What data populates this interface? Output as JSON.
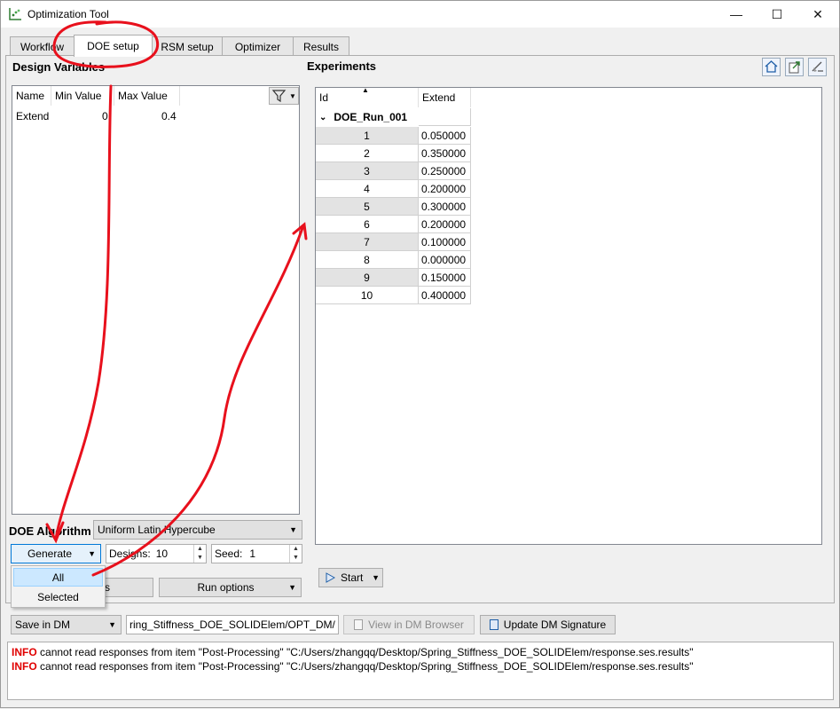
{
  "window": {
    "title": "Optimization Tool",
    "min_glyph": "—",
    "max_glyph": "☐",
    "close_glyph": "✕"
  },
  "tabs": [
    {
      "label": "Workflow"
    },
    {
      "label": "DOE setup"
    },
    {
      "label": "RSM setup"
    },
    {
      "label": "Optimizer"
    },
    {
      "label": "Results"
    }
  ],
  "design_variables": {
    "title": "Design Variables",
    "columns": [
      "Name",
      "Min Value",
      "Max Value"
    ],
    "rows": [
      {
        "name": "Extend",
        "min": "0.",
        "max": "0.4"
      }
    ]
  },
  "doe": {
    "algorithm_label": "DOE Algorithm",
    "algorithm_value": "Uniform Latin Hypercube",
    "generate_label": "Generate",
    "designs_label": "Designs:",
    "designs_value": "10",
    "seed_label": "Seed:",
    "seed_value": "1",
    "hidden_button_text": "s",
    "run_options_label": "Run options",
    "menu": [
      {
        "label": "All"
      },
      {
        "label": "Selected"
      }
    ]
  },
  "experiments": {
    "title": "Experiments",
    "columns": [
      "Id",
      "Extend"
    ],
    "group": "DOE_Run_001",
    "rows": [
      {
        "id": "1",
        "extend": "0.050000"
      },
      {
        "id": "2",
        "extend": "0.350000"
      },
      {
        "id": "3",
        "extend": "0.250000"
      },
      {
        "id": "4",
        "extend": "0.200000"
      },
      {
        "id": "5",
        "extend": "0.300000"
      },
      {
        "id": "6",
        "extend": "0.200000"
      },
      {
        "id": "7",
        "extend": "0.100000"
      },
      {
        "id": "8",
        "extend": "0.000000"
      },
      {
        "id": "9",
        "extend": "0.150000"
      },
      {
        "id": "10",
        "extend": "0.400000"
      }
    ],
    "start_label": "Start"
  },
  "bottom": {
    "save_select": "Save in DM",
    "path_value": "ring_Stiffness_DOE_SOLIDElem/OPT_DM/",
    "view_dm_label": "View in DM Browser",
    "update_dm_label": "Update DM Signature"
  },
  "log": [
    {
      "level": "INFO",
      "text": "cannot read responses from item \"Post-Processing\" \"C:/Users/zhangqq/Desktop/Spring_Stiffness_DOE_SOLIDElem/response.ses.results\""
    },
    {
      "level": "INFO",
      "text": "cannot read responses from item \"Post-Processing\" \"C:/Users/zhangqq/Desktop/Spring_Stiffness_DOE_SOLIDElem/response.ses.results\""
    }
  ],
  "colors": {
    "annotation_red": "#e8101c",
    "info_red": "#e00000",
    "selection": "#cce8ff"
  }
}
